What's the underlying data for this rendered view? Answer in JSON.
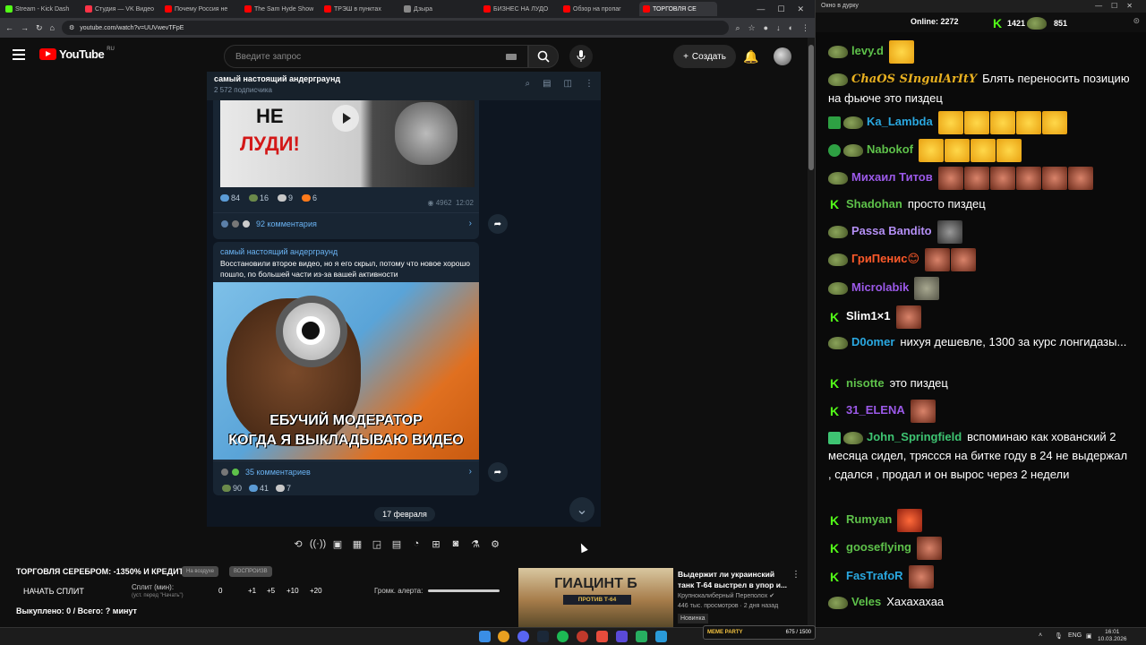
{
  "browser": {
    "tabs": [
      {
        "label": "Stream - Kick Dash",
        "color": "#53fc18"
      },
      {
        "label": "Студия — VK Видео",
        "color": "#ff3347"
      },
      {
        "label": "Почему Россия не",
        "color": "#ff0000"
      },
      {
        "label": "The Sam Hyde Show",
        "color": "#ff0000"
      },
      {
        "label": "ТРЭШ в пунктах",
        "color": "#ff0000"
      },
      {
        "label": "Дзыра",
        "color": "#888888"
      },
      {
        "label": "БИЗНЕС НА ЛУДО",
        "color": "#ff0000"
      },
      {
        "label": "Обзор на пропаг",
        "color": "#ff0000"
      },
      {
        "label": "ТОРГОВЛЯ СЕ",
        "color": "#ff0000"
      }
    ],
    "url": "youtube.com/watch?v=UUVwevTFpE"
  },
  "youtube": {
    "logo": "YouTube",
    "region": "RU",
    "search_placeholder": "Введите запрос",
    "create_label": "Создать"
  },
  "telegram": {
    "channel": "самый настоящий андерграунд",
    "subscribers": "2 572 подписчика",
    "post1": {
      "img_text1": "НЕ",
      "img_text2": "ЛУДИ!",
      "reactions": [
        {
          "count": "84",
          "color": "#5b9bd5"
        },
        {
          "count": "16",
          "color": "#6b8a4a"
        },
        {
          "count": "9",
          "color": "#c8c8c8"
        },
        {
          "count": "6",
          "color": "#ff7a1a"
        }
      ],
      "views": "4962",
      "time": "12:02",
      "comments": "92 комментария"
    },
    "post2": {
      "author": "самый настоящий андерграунд",
      "text": "Восстановили второе видео, но я его скрыл, потому что новое хорошо пошло, по большей части из-за вашей активности",
      "caption1": "ЕБУЧИЙ МОДЕРАТОР",
      "caption2": "КОГДА Я ВЫКЛАДЫВАЮ ВИДЕО",
      "comments": "35 комментариев",
      "reactions": [
        {
          "count": "90",
          "color": "#6b8a4a"
        },
        {
          "count": "41",
          "color": "#5b9bd5"
        },
        {
          "count": "7",
          "color": "#c8c8c8"
        }
      ]
    },
    "date": "17 февраля"
  },
  "panel": {
    "title": "ТОРГОВЛЯ СЕРЕБРОМ: -1350% И КРЕДИТЫ",
    "pill1": "На воздухе",
    "pill2": "ВОСПРОИЗВ",
    "start_split": "НАЧАТЬ СПЛИТ",
    "split_label": "Сплит (мин):",
    "split_hint": "(уст. перед \"Начать\")",
    "split_value": "0",
    "increments": [
      "+1",
      "+5",
      "+10",
      "+20"
    ],
    "volume_label": "Громк. алерта:",
    "bought": "Выкуплено: 0 / Всего: ? минут"
  },
  "recommended": {
    "thumb_title": "ГИАЦИНТ Б",
    "thumb_sub": "ПРОТИВ Т-64",
    "title": "Выдержит ли украинский танк Т-64 выстрел в упор и...",
    "channel": "Крупнокалиберный Переполох",
    "views": "446 тыс. просмотров · 2 дня назад",
    "badge": "Новинка"
  },
  "chat": {
    "window_title": "Окно в дурку",
    "online_label": "Online:",
    "online": "2272",
    "stat_k": "1421",
    "stat_f": "851",
    "messages": [
      {
        "user": "levy.d",
        "color": "#5ec14a",
        "text": "",
        "emotes": [
          "em-y"
        ]
      },
      {
        "user": "ChaOS SIngulArItY",
        "color": "#e8b020",
        "text": "Блять переносить позицию на фьюче это пиздец",
        "emotes": []
      },
      {
        "user": "Ka_Lambda",
        "color": "#2aa8e0",
        "text": "",
        "emotes": [
          "em-y",
          "em-y",
          "em-y",
          "em-y",
          "em-y"
        ]
      },
      {
        "user": "Nabokof",
        "color": "#5ec14a",
        "text": "",
        "emotes": [
          "em-y",
          "em-y",
          "em-y",
          "em-y"
        ]
      },
      {
        "user": "Михаил Титов",
        "color": "#9b59e8",
        "text": "",
        "emotes": [
          "em-f",
          "em-f",
          "em-f",
          "em-f",
          "em-f",
          "em-f"
        ]
      },
      {
        "user": "Shadohan",
        "color": "#5ec14a",
        "text": "просто пиздец",
        "emotes": []
      },
      {
        "user": "Passa Bandito",
        "color": "#b48ff5",
        "text": "",
        "emotes": [
          "em-s"
        ]
      },
      {
        "user": "ГриПенис😊",
        "color": "#ff5a2a",
        "text": "",
        "emotes": [
          "em-f",
          "em-f"
        ]
      },
      {
        "user": "Microlabik",
        "color": "#9b59e8",
        "text": "",
        "emotes": [
          "em-g"
        ]
      },
      {
        "user": "Slim1×1",
        "color": "#ffffff",
        "text": "",
        "emotes": [
          "em-f"
        ]
      },
      {
        "user": "D0omer",
        "color": "#2aa8e0",
        "text": "нихуя дешевле, 1300 за курс лонгидазы...",
        "emotes": []
      },
      {
        "user": "nisotte",
        "color": "#5ec14a",
        "text": "это пиздец",
        "emotes": []
      },
      {
        "user": "31_ELENA",
        "color": "#9b59e8",
        "text": "",
        "emotes": [
          "em-f"
        ]
      },
      {
        "user": "John_Springfield",
        "color": "#3ec472",
        "text": "вспоминаю как хованский 2 месяца сидел, трясcся на битке году в 24 не выдержал , сдался , продал и он вырос через 2 недели",
        "emotes": []
      },
      {
        "user": "Rumyan",
        "color": "#5ec14a",
        "text": "",
        "emotes": [
          "em-r"
        ]
      },
      {
        "user": "gooseflying",
        "color": "#5ec14a",
        "text": "",
        "emotes": [
          "em-f"
        ]
      },
      {
        "user": "FasTrafoR",
        "color": "#2aa8e0",
        "text": "",
        "emotes": [
          "em-f"
        ]
      },
      {
        "user": "Veles",
        "color": "#5ec14a",
        "text": "Хахахахаа",
        "emotes": []
      }
    ]
  },
  "taskbar": {
    "lang": "ENG",
    "time": "16:01",
    "date": "10.03.2026",
    "promo_label": "MEME PARTY",
    "promo_count": "675 / 1500"
  }
}
